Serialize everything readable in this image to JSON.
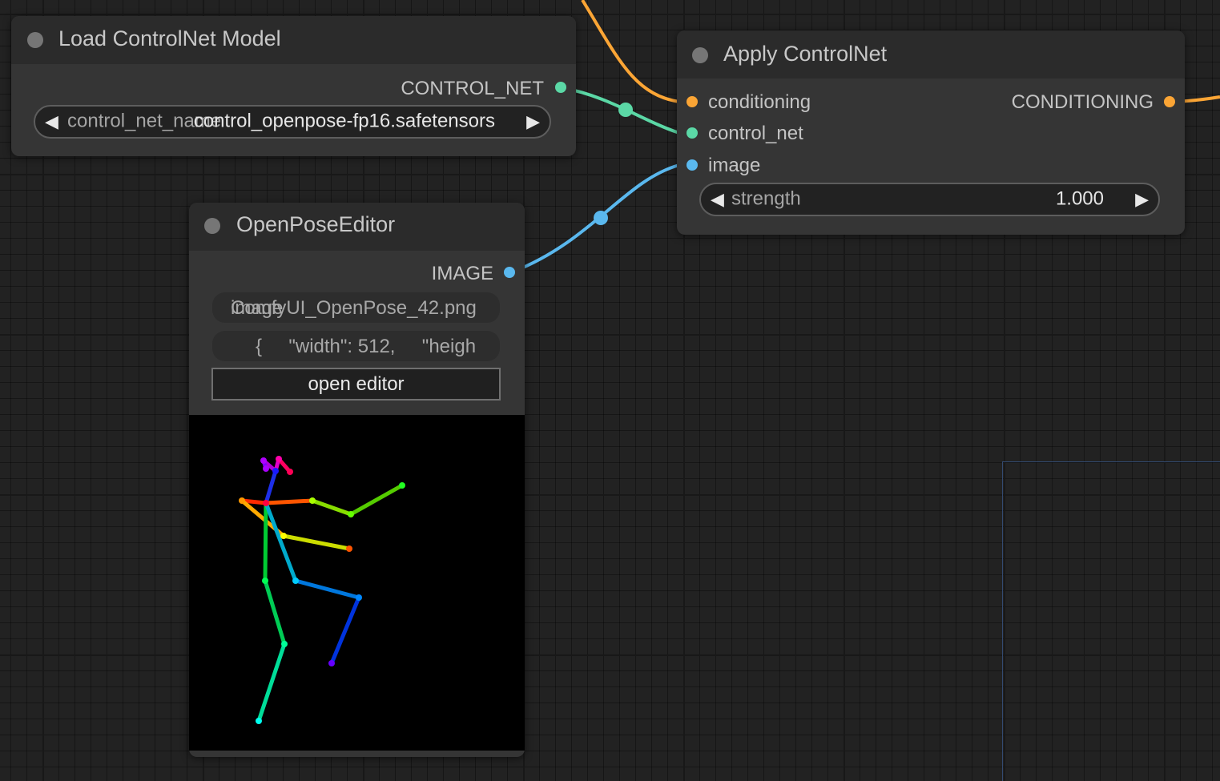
{
  "colors": {
    "conditioning": "#fba535",
    "control_net": "#5bd8a6",
    "image": "#5ab8ee"
  },
  "load_controlnet": {
    "title": "Load ControlNet Model",
    "output_label": "CONTROL_NET",
    "combo_name": "control_net_name",
    "combo_value": "control_openpose-fp16.safetensors"
  },
  "apply_controlnet": {
    "title": "Apply ControlNet",
    "inputs": [
      "conditioning",
      "control_net",
      "image"
    ],
    "output_label": "CONDITIONING",
    "strength_name": "strength",
    "strength_value": "1.000"
  },
  "openpose_editor": {
    "title": "OpenPoseEditor",
    "output_label": "IMAGE",
    "image_field_behind": "image",
    "image_field": "ComfyUI_OpenPose_42.png",
    "json_field": "{     \"width\": 512,     \"heigh",
    "button_label": "open editor"
  }
}
